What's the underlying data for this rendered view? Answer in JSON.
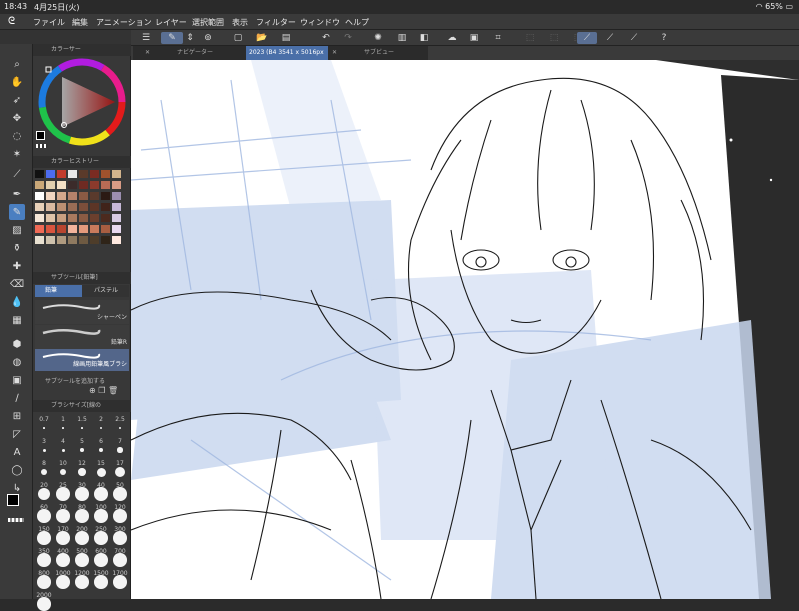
{
  "status": {
    "time": "18:43",
    "date": "4月25日(火)",
    "battery": "65%"
  },
  "menu": [
    "ファイル",
    "編集",
    "アニメーション",
    "レイヤー",
    "選択範囲",
    "表示",
    "フィルター",
    "ウィンドウ",
    "ヘルプ"
  ],
  "panels": {
    "color_wheel_title": "カラーサー",
    "color_history_title": "カラーヒストリー",
    "subtool_title": "サブツール[鉛筆]",
    "subtool_tabs": [
      "鉛筆",
      "パステル"
    ],
    "brushes": [
      "シャーペン",
      "鉛筆R",
      "線画用鉛筆風ブラシ"
    ],
    "subtool_add": "サブツールを追加する",
    "brush_size_title": "ブラシサイズ[線の",
    "brush_sizes": [
      "0.7",
      "1",
      "1.5",
      "2",
      "2.5",
      "3",
      "4",
      "5",
      "6",
      "7",
      "8",
      "10",
      "12",
      "15",
      "17",
      "20",
      "25",
      "30",
      "40",
      "50",
      "60",
      "70",
      "80",
      "100",
      "120",
      "150",
      "170",
      "200",
      "250",
      "300",
      "350",
      "400",
      "500",
      "600",
      "700",
      "800",
      "1000",
      "1200",
      "1500",
      "1700",
      "2000"
    ]
  },
  "tabs": {
    "navigator": "ナビゲーター",
    "document": "2023 (B4 3541 x 5016px",
    "subview": "サブビュー"
  },
  "colors": {
    "accent": "#4a7fc1",
    "canvas_bg": "#ffffff"
  }
}
